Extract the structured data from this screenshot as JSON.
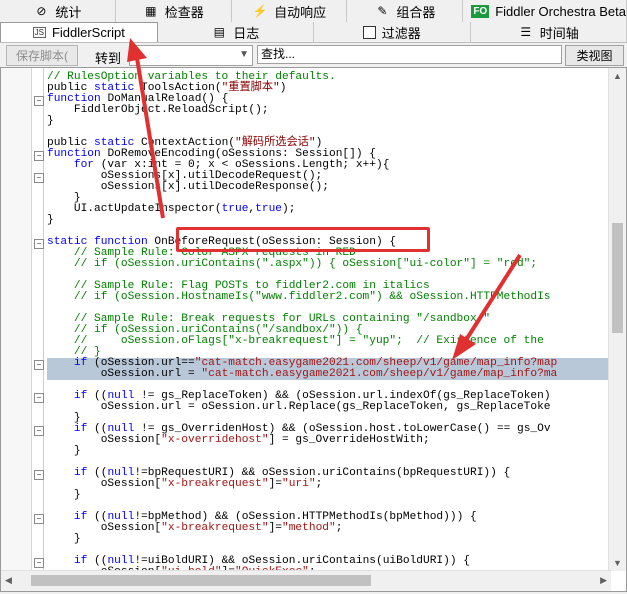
{
  "tabs_row1": [
    {
      "icon": "stats-icon",
      "glyph": "⊘",
      "label": "统计"
    },
    {
      "icon": "inspector-icon",
      "glyph": "▦",
      "label": "检查器"
    },
    {
      "icon": "lightning-icon",
      "glyph": "⚡",
      "label": "自动响应"
    },
    {
      "icon": "composer-icon",
      "glyph": "✎",
      "label": "组合器"
    },
    {
      "icon": "fo-icon",
      "glyph": "FO",
      "label": "Fiddler Orchestra Beta"
    }
  ],
  "tabs_row2": [
    {
      "icon": "js-icon",
      "glyph": "JS",
      "label": "FiddlerScript"
    },
    {
      "icon": "log-icon",
      "glyph": "▤",
      "label": "日志"
    },
    {
      "icon": "filter-checkbox-icon",
      "glyph": "",
      "label": "过滤器"
    },
    {
      "icon": "timeline-icon",
      "glyph": "☰",
      "label": "时间轴"
    }
  ],
  "toolbar": {
    "save_label": "保存脚本(",
    "goto_label": "转到",
    "find_placeholder": "查找...",
    "classview_label": "类视图"
  },
  "code_lines": [
    [
      [
        "cm",
        "// RulesOption variables to their defaults."
      ]
    ],
    [
      [
        "nm",
        "public "
      ],
      [
        "kw",
        "static "
      ],
      [
        "nm",
        "ToolsAction("
      ],
      [
        "stg",
        "\"重置脚本\""
      ],
      [
        "nm",
        ")"
      ]
    ],
    [
      [
        "kw",
        "function "
      ],
      [
        "nm",
        "DoManualReload() {"
      ]
    ],
    [
      [
        "nm",
        "    FiddlerObject.ReloadScript();"
      ]
    ],
    [
      [
        "nm",
        "}"
      ]
    ],
    [
      [
        "nm",
        ""
      ]
    ],
    [
      [
        "nm",
        "public "
      ],
      [
        "kw",
        "static "
      ],
      [
        "nm",
        "ContextAction("
      ],
      [
        "stg",
        "\"解码所选会话\""
      ],
      [
        "nm",
        ")"
      ]
    ],
    [
      [
        "kw",
        "function "
      ],
      [
        "nm",
        "DoRemoveEncoding(oSessions: Session[]) {"
      ]
    ],
    [
      [
        "nm",
        "    "
      ],
      [
        "kw",
        "for "
      ],
      [
        "nm",
        "(var x:int = 0; x < oSessions.Length; x++){"
      ]
    ],
    [
      [
        "nm",
        "        oSessions[x].utilDecodeRequest();"
      ]
    ],
    [
      [
        "nm",
        "        oSessions[x].utilDecodeResponse();"
      ]
    ],
    [
      [
        "nm",
        "    }"
      ]
    ],
    [
      [
        "nm",
        "    UI.actUpdateInspector("
      ],
      [
        "kw",
        "true"
      ],
      [
        "nm",
        ","
      ],
      [
        "kw",
        "true"
      ],
      [
        "nm",
        ");"
      ]
    ],
    [
      [
        "nm",
        "}"
      ]
    ],
    [
      [
        "nm",
        ""
      ]
    ],
    [
      [
        "kw",
        "static function "
      ],
      [
        "nm",
        "OnBeforeRequest(oSession: Session) {"
      ]
    ],
    [
      [
        "cm",
        "    // Sample Rule: Color ASPX requests in RED"
      ]
    ],
    [
      [
        "cm",
        "    // if (oSession.uriContains(\".aspx\")) { oSession[\"ui-color\"] = \"red\";"
      ]
    ],
    [
      [
        "nm",
        ""
      ]
    ],
    [
      [
        "cm",
        "    // Sample Rule: Flag POSTs to fiddler2.com in italics"
      ]
    ],
    [
      [
        "cm",
        "    // if (oSession.HostnameIs(\"www.fiddler2.com\") && oSession.HTTPMethodIs"
      ]
    ],
    [
      [
        "nm",
        ""
      ]
    ],
    [
      [
        "cm",
        "    // Sample Rule: Break requests for URLs containing \"/sandbox/\""
      ]
    ],
    [
      [
        "cm",
        "    // if (oSession.uriContains(\"/sandbox/\")) {"
      ]
    ],
    [
      [
        "cm",
        "    //     oSession.oFlags[\"x-breakrequest\"] = \"yup\";  // Existence of the"
      ]
    ],
    [
      [
        "cm",
        "    // }"
      ]
    ],
    [
      [
        "nm",
        "    "
      ],
      [
        "kw",
        "if "
      ],
      [
        "nm",
        "(oSession.url=="
      ],
      [
        "st",
        "\"cat-match.easygame2021.com/sheep/v1/game/map_info?map"
      ]
    ],
    [
      [
        "nm",
        "        oSession.url = "
      ],
      [
        "st",
        "\"cat-match.easygame2021.com/sheep/v1/game/map_info?ma"
      ]
    ],
    [
      [
        "nm",
        ""
      ]
    ],
    [
      [
        "nm",
        "    "
      ],
      [
        "kw",
        "if "
      ],
      [
        "nm",
        "(("
      ],
      [
        "kw",
        "null "
      ],
      [
        "nm",
        "!= gs_ReplaceToken) && (oSession.url.indexOf(gs_ReplaceToken)"
      ]
    ],
    [
      [
        "nm",
        "        oSession.url = oSession.url.Replace(gs_ReplaceToken, gs_ReplaceToke"
      ]
    ],
    [
      [
        "nm",
        "    }"
      ]
    ],
    [
      [
        "nm",
        "    "
      ],
      [
        "kw",
        "if "
      ],
      [
        "nm",
        "(("
      ],
      [
        "kw",
        "null "
      ],
      [
        "nm",
        "!= gs_OverridenHost) && (oSession.host.toLowerCase() == gs_Ov"
      ]
    ],
    [
      [
        "nm",
        "        oSession["
      ],
      [
        "st",
        "\"x-overridehost\""
      ],
      [
        "nm",
        "] = gs_OverrideHostWith;"
      ]
    ],
    [
      [
        "nm",
        "    }"
      ]
    ],
    [
      [
        "nm",
        ""
      ]
    ],
    [
      [
        "nm",
        "    "
      ],
      [
        "kw",
        "if "
      ],
      [
        "nm",
        "(("
      ],
      [
        "kw",
        "null"
      ],
      [
        "nm",
        "!=bpRequestURI) && oSession.uriContains(bpRequestURI)) {"
      ]
    ],
    [
      [
        "nm",
        "        oSession["
      ],
      [
        "st",
        "\"x-breakrequest\""
      ],
      [
        "nm",
        "]="
      ],
      [
        "st",
        "\"uri\""
      ],
      [
        "nm",
        ";"
      ]
    ],
    [
      [
        "nm",
        "    }"
      ]
    ],
    [
      [
        "nm",
        ""
      ]
    ],
    [
      [
        "nm",
        "    "
      ],
      [
        "kw",
        "if "
      ],
      [
        "nm",
        "(("
      ],
      [
        "kw",
        "null"
      ],
      [
        "nm",
        "!=bpMethod) && (oSession.HTTPMethodIs(bpMethod))) {"
      ]
    ],
    [
      [
        "nm",
        "        oSession["
      ],
      [
        "st",
        "\"x-breakrequest\""
      ],
      [
        "nm",
        "]="
      ],
      [
        "st",
        "\"method\""
      ],
      [
        "nm",
        ";"
      ]
    ],
    [
      [
        "nm",
        "    }"
      ]
    ],
    [
      [
        "nm",
        ""
      ]
    ],
    [
      [
        "nm",
        "    "
      ],
      [
        "kw",
        "if "
      ],
      [
        "nm",
        "(("
      ],
      [
        "kw",
        "null"
      ],
      [
        "nm",
        "!=uiBoldURI) && oSession.uriContains(uiBoldURI)) {"
      ]
    ],
    [
      [
        "nm",
        "        oSession["
      ],
      [
        "st",
        "\"ui-bold\""
      ],
      [
        "nm",
        "]="
      ],
      [
        "st",
        "\"QuickExec\""
      ],
      [
        "nm",
        ";"
      ]
    ]
  ],
  "highlight_colors": {
    "annotation": "#e03030",
    "selection": "#b8c8d8"
  }
}
